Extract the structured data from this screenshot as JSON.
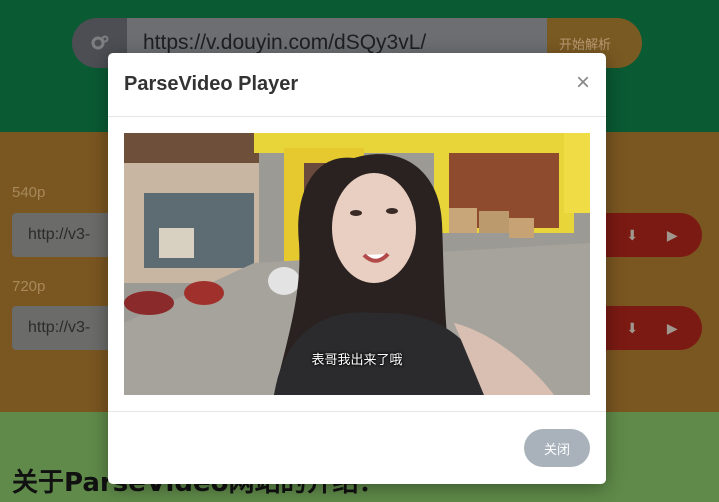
{
  "search": {
    "url_value": "https://v.douyin.com/dSQy3vL/",
    "parse_button": "开始解析"
  },
  "results": [
    {
      "quality": "540p",
      "url": "http://v3-"
    },
    {
      "quality": "720p",
      "url": "http://v3-"
    }
  ],
  "about": {
    "title": "关于ParseVideo网站的介绍："
  },
  "modal": {
    "title": "ParseVideo Player",
    "close_symbol": "×",
    "subtitle": "表哥我出来了哦",
    "footer_close": "关闭"
  },
  "colors": {
    "hero_bg": "#0a5a34",
    "results_bg": "#7a5621",
    "about_bg": "#5f8a49",
    "action_red": "#7b1a13",
    "close_button": "#a9b2ba"
  },
  "icons": [
    "gear-icon",
    "download-icon",
    "play-icon",
    "close-icon"
  ]
}
